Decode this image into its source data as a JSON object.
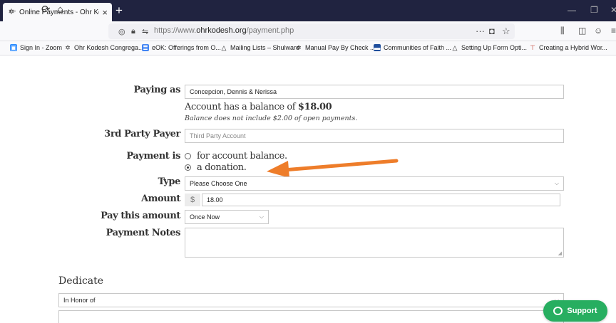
{
  "browser": {
    "tab_title": "Online Payments - Ohr Kodesh",
    "tab_favicon": "ohr-kodesh-favicon",
    "url_prefix": "https://www.",
    "url_domain": "ohrkodesh.org",
    "url_path": "/payment.php"
  },
  "bookmarks": [
    {
      "label": "Sign In - Zoom",
      "icon": "zoom-icon",
      "color": "#2d8cff"
    },
    {
      "label": "Ohr Kodesh Congrega...",
      "icon": "ohr-kodesh-favicon",
      "color": "#666666"
    },
    {
      "label": "eOK: Offerings from O...",
      "icon": "doc-icon",
      "color": "#4285f4"
    },
    {
      "label": "Mailing Lists – Shulware",
      "icon": "drive-icon",
      "color": "#666666"
    },
    {
      "label": "Manual Pay By Check ...",
      "icon": "ohr-kodesh-favicon",
      "color": "#666666"
    },
    {
      "label": "Communities of Faith ...",
      "icon": "site-icon",
      "color": "#1f4e9c"
    },
    {
      "label": "Setting Up Form Opti...",
      "icon": "drive-icon",
      "color": "#666666"
    },
    {
      "label": "Creating a Hybrid Wor...",
      "icon": "bookmark-icon",
      "color": "#c0392b"
    }
  ],
  "form": {
    "paying_as_label": "Paying as",
    "paying_as_value": "Concepcion, Dennis & Nerissa",
    "balance_text": "Account has a balance of ",
    "balance_amount": "$18.00",
    "balance_note": "Balance does not include $2.00 of open payments.",
    "third_party_label": "3rd Party Payer",
    "third_party_placeholder": "Third Party Account",
    "payment_is_label": "Payment is",
    "payment_options": [
      {
        "label": "for account balance.",
        "selected": false
      },
      {
        "label": "a donation.",
        "selected": true
      }
    ],
    "type_label": "Type",
    "type_value": "Please Choose One",
    "amount_label": "Amount",
    "currency_symbol": "$",
    "amount_value": "18.00",
    "pay_this_amount_label": "Pay this amount",
    "pay_this_amount_value": "Once Now",
    "payment_notes_label": "Payment Notes",
    "dedicate_heading": "Dedicate",
    "dedicate_value": "In Honor of"
  },
  "support_button": "Support",
  "colors": {
    "arrow": "#ee7d2a",
    "support": "#27ae60",
    "titlebar": "#202340"
  }
}
